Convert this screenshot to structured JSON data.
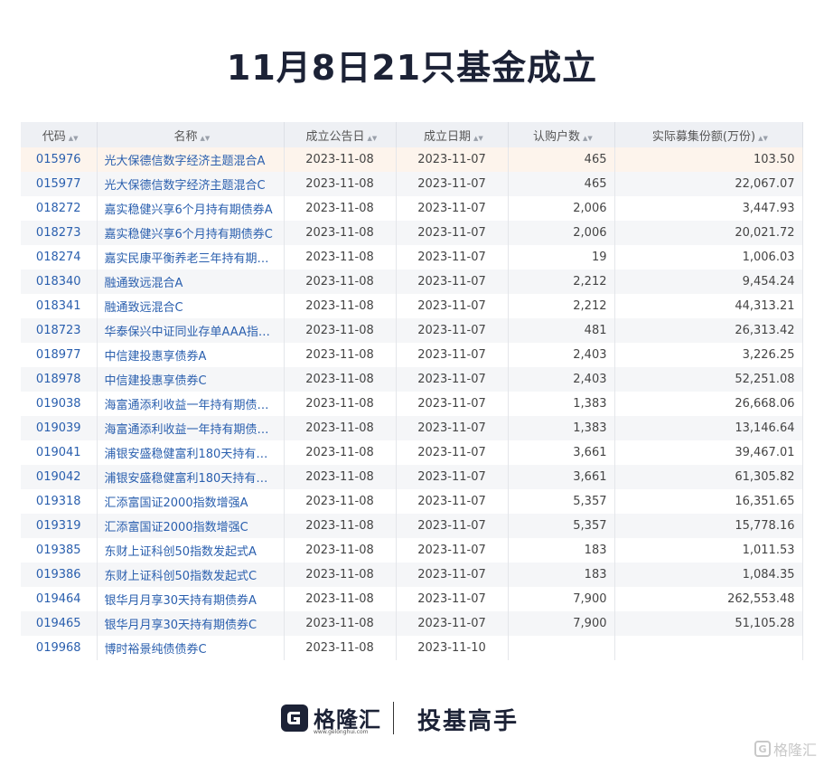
{
  "title": "11月8日21只基金成立",
  "table": {
    "headers": [
      "代码",
      "名称",
      "成立公告日",
      "成立日期",
      "认购户数",
      "实际募集份额(万份)"
    ],
    "sort_icon": "sort-icon",
    "rows": [
      [
        "015976",
        "光大保德信数字经济主题混合A",
        "2023-11-08",
        "2023-11-07",
        "465",
        "103.50"
      ],
      [
        "015977",
        "光大保德信数字经济主题混合C",
        "2023-11-08",
        "2023-11-07",
        "465",
        "22,067.07"
      ],
      [
        "018272",
        "嘉实稳健兴享6个月持有期债券A",
        "2023-11-08",
        "2023-11-07",
        "2,006",
        "3,447.93"
      ],
      [
        "018273",
        "嘉实稳健兴享6个月持有期债券C",
        "2023-11-08",
        "2023-11-07",
        "2,006",
        "20,021.72"
      ],
      [
        "018274",
        "嘉实民康平衡养老三年持有期混...",
        "2023-11-08",
        "2023-11-07",
        "19",
        "1,006.03"
      ],
      [
        "018340",
        "融通致远混合A",
        "2023-11-08",
        "2023-11-07",
        "2,212",
        "9,454.24"
      ],
      [
        "018341",
        "融通致远混合C",
        "2023-11-08",
        "2023-11-07",
        "2,212",
        "44,313.21"
      ],
      [
        "018723",
        "华泰保兴中证同业存单AAA指数...",
        "2023-11-08",
        "2023-11-07",
        "481",
        "26,313.42"
      ],
      [
        "018977",
        "中信建投惠享债券A",
        "2023-11-08",
        "2023-11-07",
        "2,403",
        "3,226.25"
      ],
      [
        "018978",
        "中信建投惠享债券C",
        "2023-11-08",
        "2023-11-07",
        "2,403",
        "52,251.08"
      ],
      [
        "019038",
        "海富通添利收益一年持有期债券A",
        "2023-11-08",
        "2023-11-07",
        "1,383",
        "26,668.06"
      ],
      [
        "019039",
        "海富通添利收益一年持有期债券C",
        "2023-11-08",
        "2023-11-07",
        "1,383",
        "13,146.64"
      ],
      [
        "019041",
        "浦银安盛稳健富利180天持有债...",
        "2023-11-08",
        "2023-11-07",
        "3,661",
        "39,467.01"
      ],
      [
        "019042",
        "浦银安盛稳健富利180天持有债...",
        "2023-11-08",
        "2023-11-07",
        "3,661",
        "61,305.82"
      ],
      [
        "019318",
        "汇添富国证2000指数增强A",
        "2023-11-08",
        "2023-11-07",
        "5,357",
        "16,351.65"
      ],
      [
        "019319",
        "汇添富国证2000指数增强C",
        "2023-11-08",
        "2023-11-07",
        "5,357",
        "15,778.16"
      ],
      [
        "019385",
        "东财上证科创50指数发起式A",
        "2023-11-08",
        "2023-11-07",
        "183",
        "1,011.53"
      ],
      [
        "019386",
        "东财上证科创50指数发起式C",
        "2023-11-08",
        "2023-11-07",
        "183",
        "1,084.35"
      ],
      [
        "019464",
        "银华月月享30天持有期债券A",
        "2023-11-08",
        "2023-11-07",
        "7,900",
        "262,553.48"
      ],
      [
        "019465",
        "银华月月享30天持有期债券C",
        "2023-11-08",
        "2023-11-07",
        "7,900",
        "51,105.28"
      ],
      [
        "019968",
        "博时裕景纯债债券C",
        "2023-11-08",
        "2023-11-10",
        "",
        ""
      ]
    ]
  },
  "footer": {
    "logo_text": "格隆汇",
    "logo_url": "www.gelonghui.com",
    "slogan": "投基高手",
    "logo_icon": "gelonghui-logo-icon"
  },
  "watermark": {
    "text": "格隆汇",
    "icon": "gelonghui-watermark-icon"
  },
  "colors": {
    "title": "#1c2236",
    "link": "#2a5fae",
    "header_bg": "#eef0f4",
    "highlight_row": "#fdf4ec"
  }
}
